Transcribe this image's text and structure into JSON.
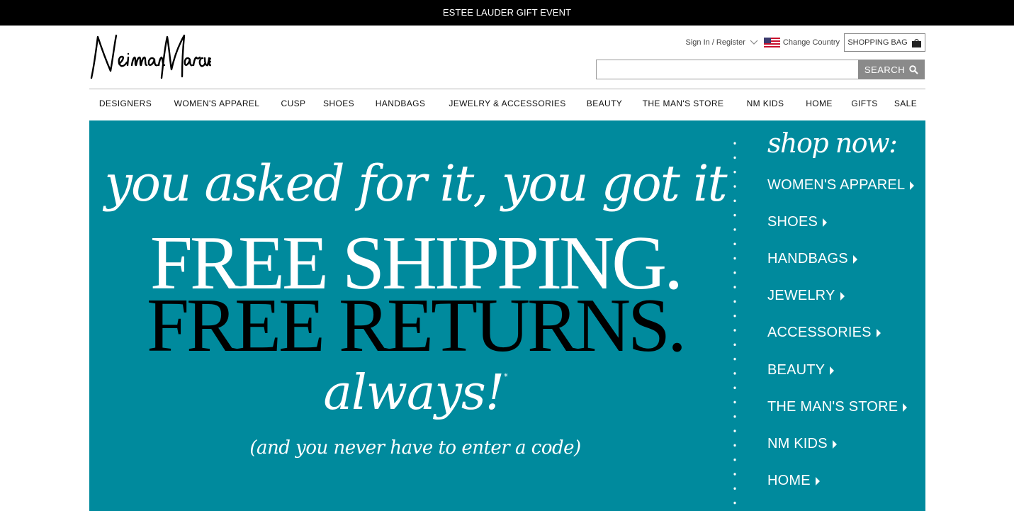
{
  "promo_bar": {
    "text": "ESTEE LAUDER GIFT EVENT"
  },
  "logo": {
    "alt": "Neiman Marcus"
  },
  "account": {
    "signin_label": "Sign In / Register",
    "country_label": "Change Country",
    "bag_label": "SHOPPING BAG"
  },
  "search": {
    "value": "",
    "placeholder": "",
    "button_label": "SEARCH"
  },
  "nav": [
    {
      "label": "DESIGNERS"
    },
    {
      "label": "WOMEN'S APPAREL"
    },
    {
      "label": "CUSP"
    },
    {
      "label": "SHOES"
    },
    {
      "label": "HANDBAGS"
    },
    {
      "label": "JEWELRY & ACCESSORIES"
    },
    {
      "label": "BEAUTY"
    },
    {
      "label": "THE MAN'S STORE"
    },
    {
      "label": "NM KIDS"
    },
    {
      "label": "HOME"
    },
    {
      "label": "GIFTS"
    },
    {
      "label": "SALE"
    }
  ],
  "hero": {
    "line1": "you asked for it, you got it",
    "line2": "FREE SHIPPING.",
    "line3": "FREE RETURNS.",
    "line4": "always!",
    "asterisk": "*",
    "line5": "(and you never have to enter a code)",
    "shop_now": "shop now:",
    "shop_links": [
      {
        "label": "WOMEN'S APPAREL"
      },
      {
        "label": "SHOES"
      },
      {
        "label": "HANDBAGS"
      },
      {
        "label": "JEWELRY"
      },
      {
        "label": "ACCESSORIES"
      },
      {
        "label": "BEAUTY"
      },
      {
        "label": "THE MAN'S STORE"
      },
      {
        "label": "NM KIDS"
      },
      {
        "label": "HOME"
      }
    ]
  },
  "colors": {
    "hero_bg": "#008a9d",
    "promo_bg": "#000000",
    "search_button": "#8a8a8a"
  }
}
